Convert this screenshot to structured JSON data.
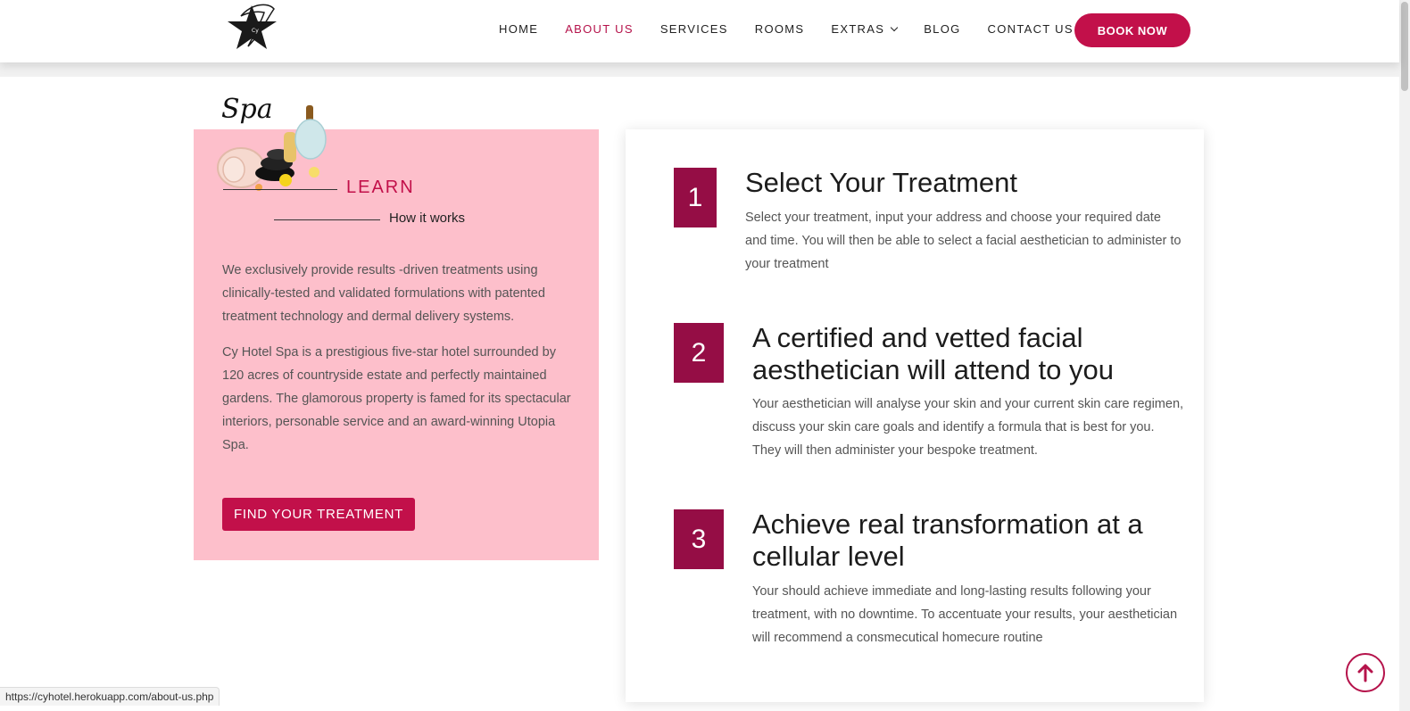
{
  "header": {
    "nav": [
      {
        "label": "HOME",
        "active": false
      },
      {
        "label": "ABOUT US",
        "active": true
      },
      {
        "label": "SERVICES",
        "active": false
      },
      {
        "label": "ROOMS",
        "active": false
      },
      {
        "label": "EXTRAS",
        "active": false,
        "dropdown": true
      },
      {
        "label": "BLOG",
        "active": false
      },
      {
        "label": "CONTACT US",
        "active": false
      }
    ],
    "book_label": "BOOK NOW",
    "logo_icon": "star-logo-icon"
  },
  "learn": {
    "spa_script": "Spa",
    "kicker": "LEARN",
    "subtitle": "How it works",
    "para1": "We exclusively provide results -driven treatments using clinically-tested and validated formulations with patented treatment technology and dermal delivery systems.",
    "para2": "Cy Hotel Spa is a prestigious five-star hotel surrounded by 120 acres of countryside estate and perfectly maintained gardens. The glamorous property is famed for its spectacular interiors, personable service and an award-winning Utopia Spa.",
    "cta_label": "FIND YOUR TREATMENT"
  },
  "steps": [
    {
      "number": "1",
      "title": "Select Your Treatment",
      "text": "Select your treatment, input your address and choose your required date and time. You will then be able to select a facial aesthetician to administer to your treatment"
    },
    {
      "number": "2",
      "title": "A certified and vetted facial aesthetician will attend to you",
      "text": "Your aesthetician will analyse your skin and your current skin care regimen, discuss your skin care goals and identify a formula that is best for you. They will then administer your bespoke treatment."
    },
    {
      "number": "3",
      "title": "Achieve real transformation at a cellular level",
      "text": "Your should achieve immediate and long-lasting results following your treatment, with no downtime. To accentuate your results, your aesthetician will recommend a consmecutical homecure routine"
    }
  ],
  "status_url": "https://cyhotel.herokuapp.com/about-us.php",
  "colors": {
    "accent": "#c2104a",
    "step_box": "#950d45",
    "pink_bg": "#fdbfcb"
  }
}
